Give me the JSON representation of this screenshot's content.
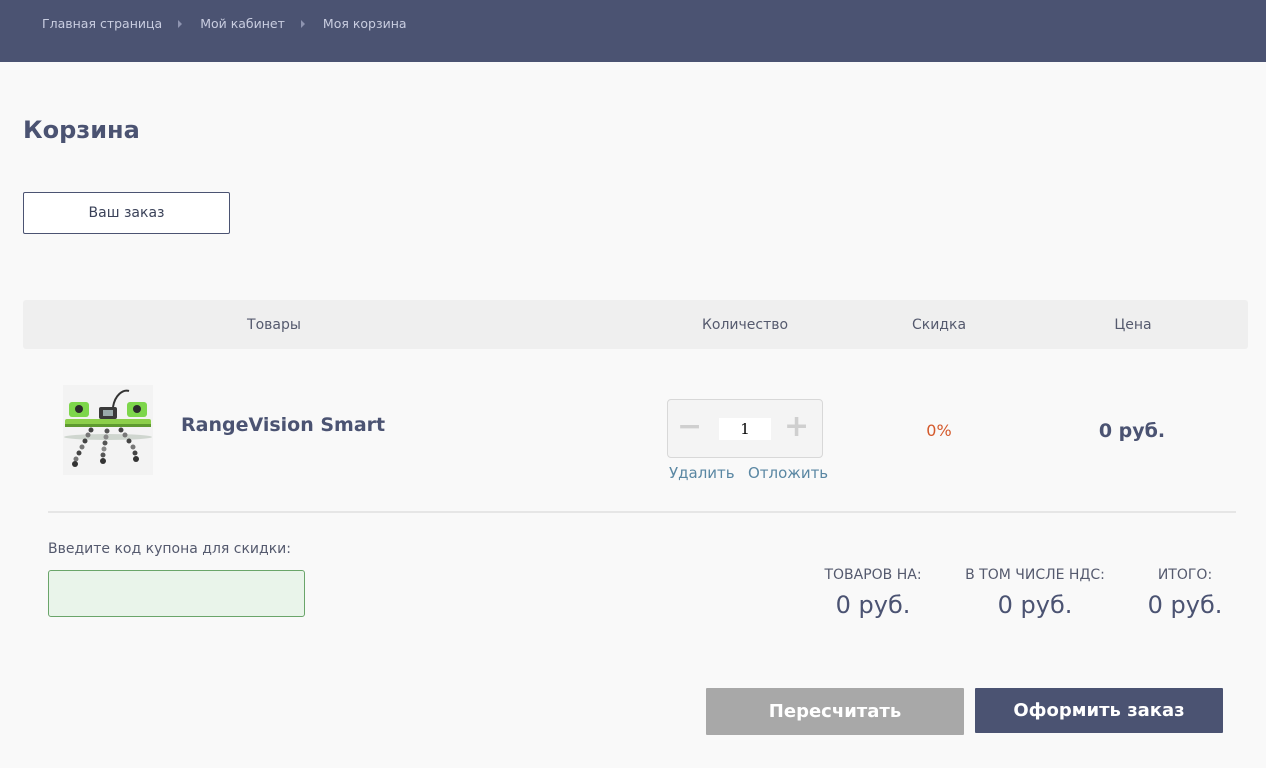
{
  "breadcrumb": [
    {
      "label": "Главная страница"
    },
    {
      "label": "Мой кабинет"
    },
    {
      "label": "Моя корзина"
    }
  ],
  "page": {
    "title": "Корзина"
  },
  "order_button": {
    "label": "Ваш заказ"
  },
  "table": {
    "headers": {
      "goods": "Товары",
      "quantity": "Количество",
      "discount": "Скидка",
      "price": "Цена"
    },
    "rows": [
      {
        "name": "RangeVision Smart",
        "quantity": "1",
        "discount": "0%",
        "price": "0 руб.",
        "delete_label": "Удалить",
        "postpone_label": "Отложить"
      }
    ]
  },
  "icons": {
    "minus": "−",
    "plus": "+"
  },
  "coupon": {
    "label": "Введите код купона для скидки:",
    "value": "",
    "placeholder": ""
  },
  "summary": {
    "goods_label": "ТОВАРОВ НА:",
    "goods_value": "0 руб.",
    "vat_label": "В ТОМ ЧИСЛЕ НДС:",
    "vat_value": "0 руб.",
    "total_label": "ИТОГО:",
    "total_value": "0 руб."
  },
  "actions": {
    "recalculate": "Пересчитать",
    "checkout": "Оформить заказ"
  },
  "colors": {
    "header_bg": "#4b5372",
    "accent_text": "#4b5372",
    "discount": "#d4592b",
    "link": "#5a87a3",
    "recalc_bg": "#a8a8a8",
    "coupon_bg": "#e9f4ea"
  }
}
